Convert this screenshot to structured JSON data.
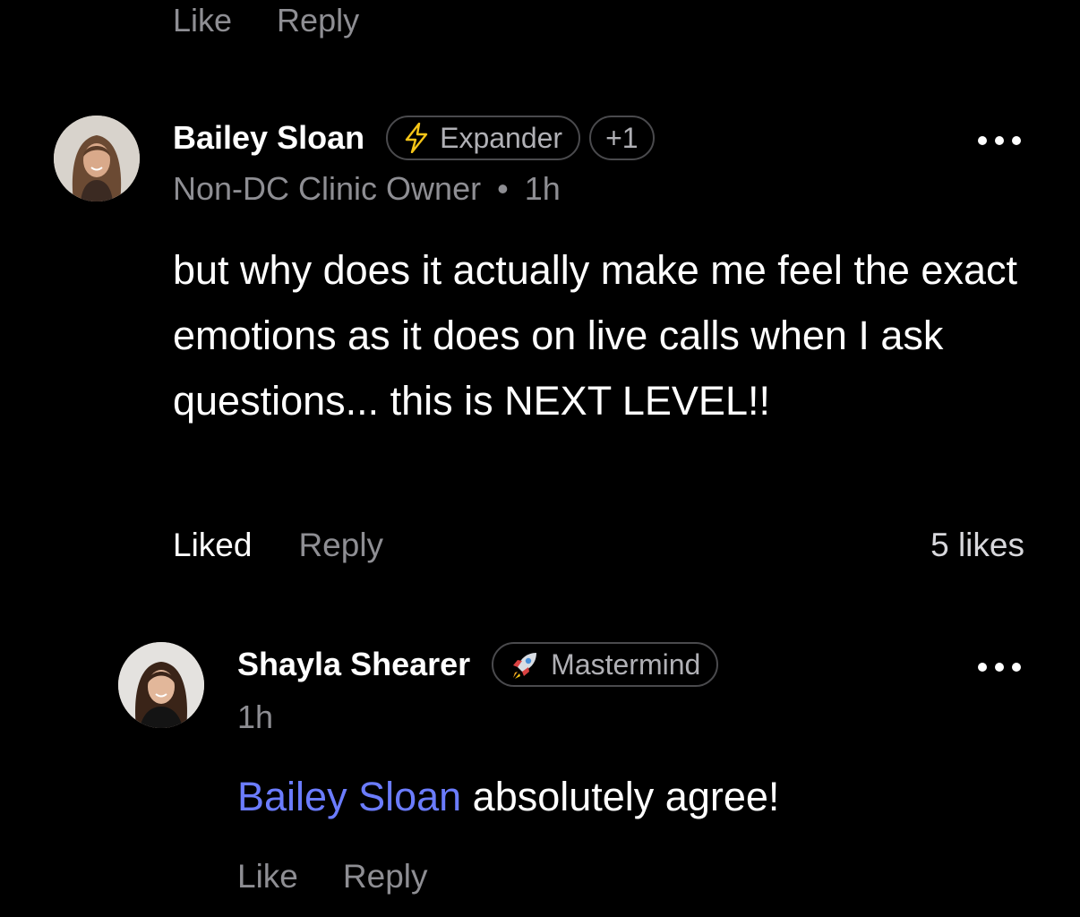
{
  "top_actions": {
    "like": "Like",
    "reply": "Reply"
  },
  "comments": [
    {
      "author": "Bailey Sloan",
      "badge": "Expander",
      "badge_icon": "lightning-icon",
      "extra_badges": "+1",
      "role": "Non-DC Clinic Owner",
      "separator": "•",
      "time": "1h",
      "body": "but why does it actually make me feel the exact emotions as it does on live calls when I ask questions... this is NEXT LEVEL!!",
      "like_label": "Liked",
      "reply_label": "Reply",
      "likes": "5 likes"
    },
    {
      "author": "Shayla Shearer",
      "badge": "Mastermind",
      "badge_icon": "rocket-icon",
      "time": "1h",
      "mention": "Bailey Sloan",
      "body": " absolutely agree!",
      "like_label": "Like",
      "reply_label": "Reply"
    }
  ],
  "colors": {
    "background": "#000000",
    "mention": "#6b7cff",
    "muted_text": "#8e8e93",
    "badge_border": "#4a4a4d"
  }
}
